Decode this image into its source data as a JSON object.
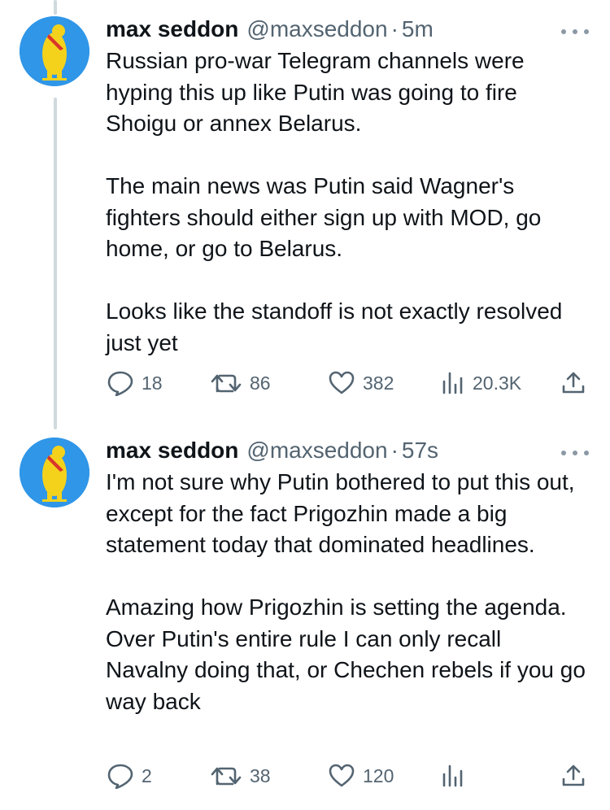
{
  "tweets": [
    {
      "author_name": "max seddon",
      "handle": "@maxseddon",
      "separator": "·",
      "time": "5m",
      "paragraphs": [
        "Russian pro-war Telegram channels were hyping this up like Putin was going to fire Shoigu or annex Belarus.",
        "The main news was Putin said Wagner's fighters should either sign up with MOD, go home, or go to Belarus.",
        "Looks like the standoff is not exactly resolved just yet"
      ],
      "replies": "18",
      "retweets": "86",
      "likes": "382",
      "views": "20.3K"
    },
    {
      "author_name": "max seddon",
      "handle": "@maxseddon",
      "separator": "·",
      "time": "57s",
      "paragraphs": [
        "I'm not sure why Putin bothered to put this out, except for the fact Prigozhin made a big statement today that dominated headlines.",
        "Amazing how Prigozhin is setting the agenda. Over Putin's entire rule I can only recall Navalny doing that, or Chechen rebels if you go way back"
      ],
      "replies": "2",
      "retweets": "38",
      "likes": "120",
      "views": ""
    }
  ],
  "icons": {
    "avatar": "yellow-bear-emblem",
    "more": "more-dots-icon",
    "reply": "reply-icon",
    "retweet": "retweet-icon",
    "like": "heart-icon",
    "views": "views-icon",
    "share": "share-icon"
  },
  "colors": {
    "text": "#0f1419",
    "secondary": "#536471",
    "thread_line": "#cfd9de",
    "avatar_bg": "#2f96e8",
    "bear": "#f4d21c"
  }
}
